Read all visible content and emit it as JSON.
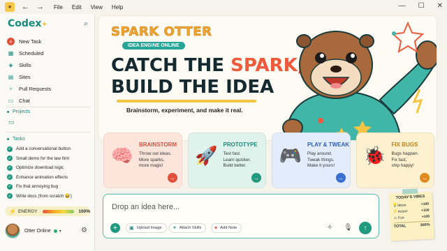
{
  "window": {
    "menu": [
      "File",
      "Edit",
      "View",
      "Help"
    ]
  },
  "sidebar": {
    "brand": "Codex",
    "nav": [
      {
        "label": "New Task",
        "icon": "plus-icon"
      },
      {
        "label": "Scheduled",
        "icon": "calendar-icon"
      },
      {
        "label": "Skills",
        "icon": "layers-icon"
      },
      {
        "label": "Sites",
        "icon": "document-icon"
      },
      {
        "label": "Pull Requests",
        "icon": "pull-request-icon"
      },
      {
        "label": "Chat",
        "icon": "chat-icon"
      }
    ],
    "projects_label": "Projects",
    "tasks_label": "Tasks",
    "tasks": [
      "Add a conversational button",
      "Small demo for the law firm",
      "Optimize download logic",
      "Enhance animation effects",
      "Fix that annoying bug",
      "Write docs (from scratch 😅)"
    ],
    "energy": {
      "label": "ENERGY",
      "value": "100%",
      "level": 1.0
    },
    "user": {
      "name": "Otter Online"
    }
  },
  "hero": {
    "tag": "SPARK OTTER",
    "badge": "IDEA ENGINE ONLINE",
    "title_line1_a": "CATCH THE ",
    "title_line1_b": "SPARK,",
    "title_line2": "BUILD THE IDEA",
    "subtitle": "Brainstorm, experiment, and make it real."
  },
  "cards": [
    {
      "title": "BRAINSTORM",
      "text": "Throw out ideas.\nMore sparks,\nmore magic!",
      "icon": "brain-icon",
      "bg": "#fde5dc",
      "title_color": "#e0503b",
      "go_color": "#e0503b"
    },
    {
      "title": "PROTOTYPE",
      "text": "Test fast.\nLearn quicker.\nBuild better.",
      "icon": "rocket-icon",
      "bg": "#dff3ec",
      "title_color": "#1f8a7c",
      "go_color": "#1f9a7e"
    },
    {
      "title": "PLAY & TWEAK",
      "text": "Play around.\nTweak things.\nMake it yours!",
      "icon": "gamepad-icon",
      "bg": "#e3ecfb",
      "title_color": "#2f5fb5",
      "go_color": "#3a6fd0"
    },
    {
      "title": "FIX BUGS",
      "text": "Bugs happen.\nFix fast,\nship happy!",
      "icon": "bug-icon",
      "bg": "#fdf1d0",
      "title_color": "#c77d12",
      "go_color": "#e08a1f"
    }
  ],
  "composer": {
    "placeholder": "Drop an idea here...",
    "chips": [
      {
        "label": "Upload Image",
        "icon": "image-icon"
      },
      {
        "label": "Attach Skills",
        "icon": "link-icon"
      },
      {
        "label": "Add Note",
        "icon": "heart-icon"
      }
    ]
  },
  "vibes": {
    "title": "TODAY'S VIBES",
    "rows": [
      {
        "label": "Ideas",
        "value": "+100",
        "icon": "lightbulb-icon"
      },
      {
        "label": "Action",
        "value": "+100",
        "icon": "bolt-icon"
      },
      {
        "label": "Fun",
        "value": "+100",
        "icon": "smile-icon"
      }
    ],
    "total_label": "TOTAL",
    "total_value": "300%"
  }
}
